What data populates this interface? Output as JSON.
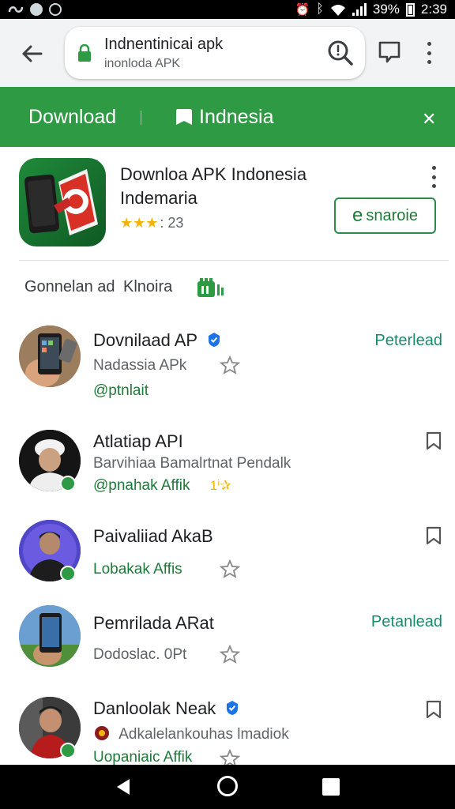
{
  "status_bar": {
    "battery": "39%",
    "time": "2:39"
  },
  "url_bar": {
    "title": "Indnentinicai apk",
    "subtitle": "inonloda APK"
  },
  "header": {
    "download": "Download",
    "indonesia": "Indnesia",
    "close_glyph": "✕"
  },
  "app": {
    "title_line1": "Downloa APK Indonesia",
    "title_line2": "Indemaria",
    "stars": "★★★",
    "rating": ": 23",
    "open_label": "snaroie",
    "open_icon_glyph": "e"
  },
  "filters": {
    "label_a": "Gonnelan ad",
    "label_b": "Klnoira"
  },
  "items": [
    {
      "title": "Dovnilaad AP",
      "subtitle": "Nadassia APk",
      "tag": "@ptnlait",
      "action": "Peterlead"
    },
    {
      "title": "Atlatiap API",
      "subtitle": "Barvihiaa Bamalrtnat Pendalk",
      "tag": "@pnahak Affik",
      "tag_extra": "1ⁱ✰"
    },
    {
      "title": "Paivaliiad AkaB",
      "tag": "Lobakak Affis"
    },
    {
      "title": "Pemrilada ARat",
      "subtitle": "Dodoslac. 0Pt",
      "action": "Petanlead"
    },
    {
      "title": "Danloolak Neak",
      "subtitle": "Adkalelankouhas lmadiok",
      "tag": "Uopaniaic Affik"
    }
  ],
  "colors": {
    "green": "#2e9a44",
    "teal_action": "#1a8a6c",
    "star": "#f4b400"
  },
  "icons": [
    "back-arrow-icon",
    "lock-icon",
    "search-icon",
    "tab-icon",
    "more-vert-icon",
    "bookmark-icon",
    "star-outline-icon",
    "verified-icon"
  ]
}
